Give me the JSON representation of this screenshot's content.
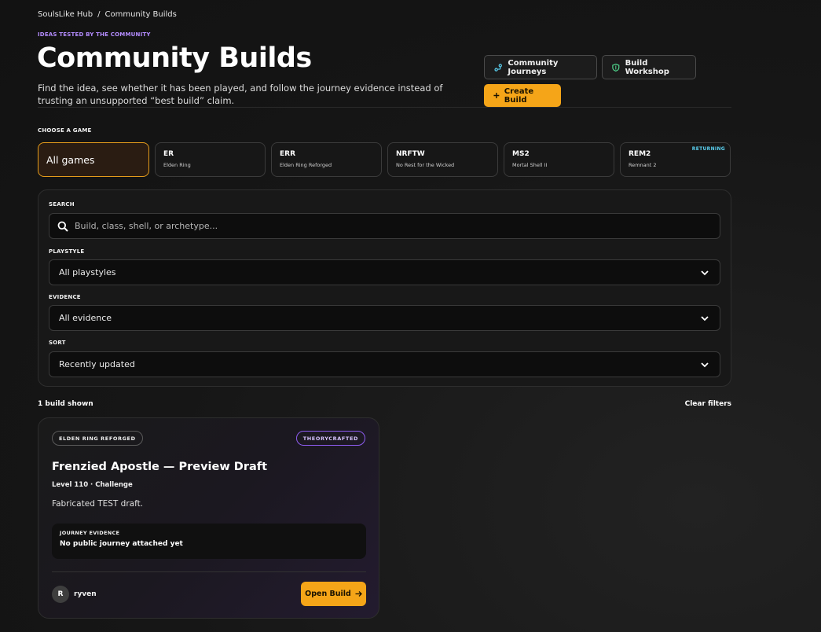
{
  "breadcrumb": {
    "home": "SoulsLike Hub",
    "separator": "/",
    "current": "Community Builds"
  },
  "header": {
    "eyebrow": "IDEAS TESTED BY THE COMMUNITY",
    "title": "Community Builds",
    "description": "Find the idea, see whether it has been played, and follow the journey evidence instead of trusting an unsupported “best build” claim.",
    "journeys_label": "Community Journeys",
    "workshop_label": "Build Workshop",
    "create_label": "Create Build"
  },
  "games": {
    "label": "CHOOSE A GAME",
    "all_label": "All games",
    "items": [
      {
        "code": "ER",
        "name": "Elden Ring"
      },
      {
        "code": "ERR",
        "name": "Elden Ring Reforged"
      },
      {
        "code": "NRFTW",
        "name": "No Rest for the Wicked"
      },
      {
        "code": "MS2",
        "name": "Mortal Shell II"
      },
      {
        "code": "REM2",
        "name": "Remnant 2",
        "badge": "RETURNING"
      }
    ]
  },
  "filters": {
    "search_label": "SEARCH",
    "search_placeholder": "Build, class, shell, or archetype...",
    "playstyle_label": "PLAYSTYLE",
    "playstyle_value": "All playstyles",
    "evidence_label": "EVIDENCE",
    "evidence_value": "All evidence",
    "sort_label": "SORT",
    "sort_value": "Recently updated"
  },
  "results": {
    "count": "1 build shown",
    "clear_label": "Clear filters"
  },
  "build": {
    "game_pill": "ELDEN RING REFORGED",
    "status_pill": "THEORYCRAFTED",
    "title": "Frenzied Apostle — Preview Draft",
    "meta": "Level 110 · Challenge",
    "description": "Fabricated TEST draft.",
    "evidence_label": "JOURNEY EVIDENCE",
    "evidence_text": "No public journey attached yet",
    "author_initial": "R",
    "author": "ryven",
    "open_label": "Open Build"
  },
  "colors": {
    "accent": "#f5a518",
    "eyebrow": "#b48cff",
    "returning": "#5ad0f0",
    "theorycrafted": "#8e5cf0"
  }
}
